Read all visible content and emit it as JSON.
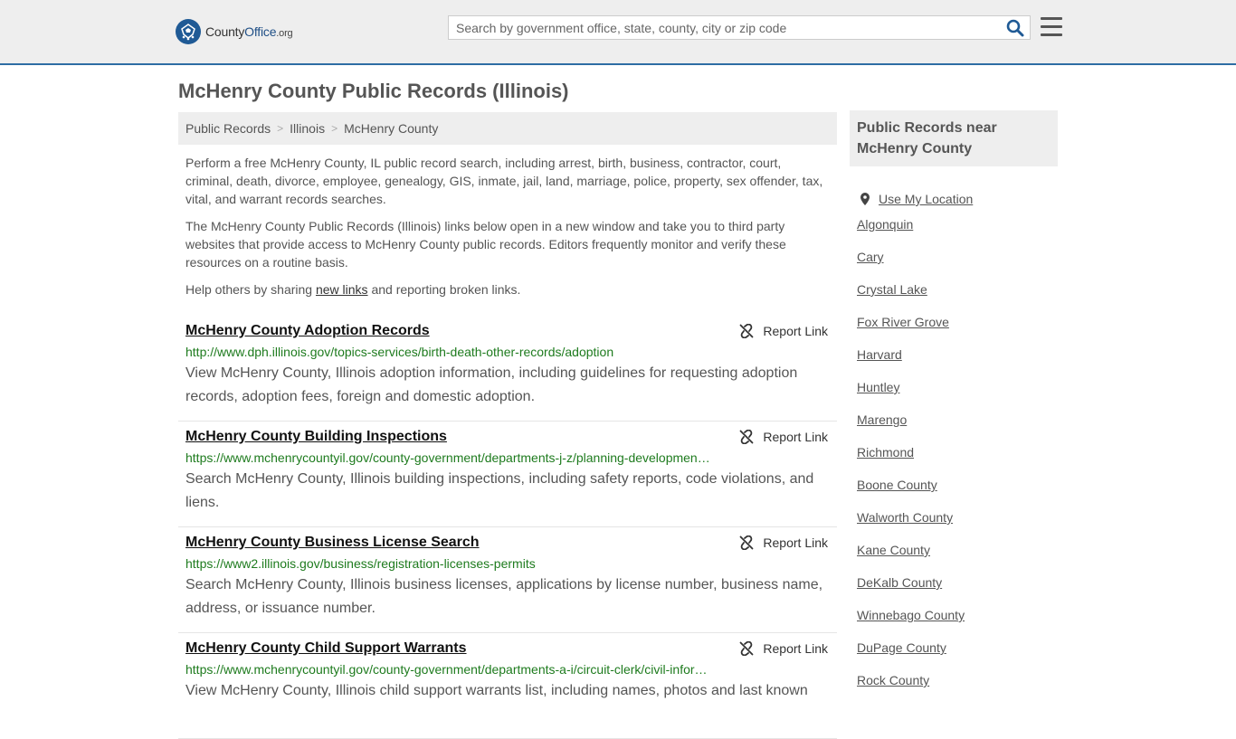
{
  "header": {
    "logo": {
      "prefix": "County",
      "brand": "Office",
      "tld": ".org"
    },
    "search_placeholder": "Search by government office, state, county, city or zip code",
    "search_icon": "search-icon",
    "menu_icon": "hamburger-menu-icon"
  },
  "page_title": "McHenry County Public Records (Illinois)",
  "breadcrumb": [
    "Public Records",
    "Illinois",
    "McHenry County"
  ],
  "intro": {
    "p1": "Perform a free McHenry County, IL public record search, including arrest, birth, business, contractor, court, criminal, death, divorce, employee, genealogy, GIS, inmate, jail, land, marriage, police, property, sex offender, tax, vital, and warrant records searches.",
    "p2": "The McHenry County Public Records (Illinois) links below open in a new window and take you to third party websites that provide access to McHenry County public records. Editors frequently monitor and verify these resources on a routine basis.",
    "p3_before": "Help others by sharing ",
    "p3_link": "new links",
    "p3_after": " and reporting broken links."
  },
  "report_label": "Report Link",
  "records": [
    {
      "title": "McHenry County Adoption Records",
      "url": "http://www.dph.illinois.gov/topics-services/birth-death-other-records/adoption",
      "desc": "View McHenry County, Illinois adoption information, including guidelines for requesting adoption records, adoption fees, foreign and domestic adoption."
    },
    {
      "title": "McHenry County Building Inspections",
      "url": "https://www.mchenrycountyil.gov/county-government/departments-j-z/planning-developmen…",
      "desc": "Search McHenry County, Illinois building inspections, including safety reports, code violations, and liens."
    },
    {
      "title": "McHenry County Business License Search",
      "url": "https://www2.illinois.gov/business/registration-licenses-permits",
      "desc": "Search McHenry County, Illinois business licenses, applications by license number, business name, address, or issuance number."
    },
    {
      "title": "McHenry County Child Support Warrants",
      "url": "https://www.mchenrycountyil.gov/county-government/departments-a-i/circuit-clerk/civil-infor…",
      "desc": "View McHenry County, Illinois child support warrants list, including names, photos and last known"
    }
  ],
  "sidebar": {
    "heading": "Public Records near McHenry County",
    "use_location": "Use My Location",
    "places": [
      "Algonquin",
      "Cary",
      "Crystal Lake",
      "Fox River Grove",
      "Harvard",
      "Huntley",
      "Marengo",
      "Richmond",
      "Boone County",
      "Walworth County",
      "Kane County",
      "DeKalb County",
      "Winnebago County",
      "DuPage County",
      "Rock County"
    ]
  }
}
